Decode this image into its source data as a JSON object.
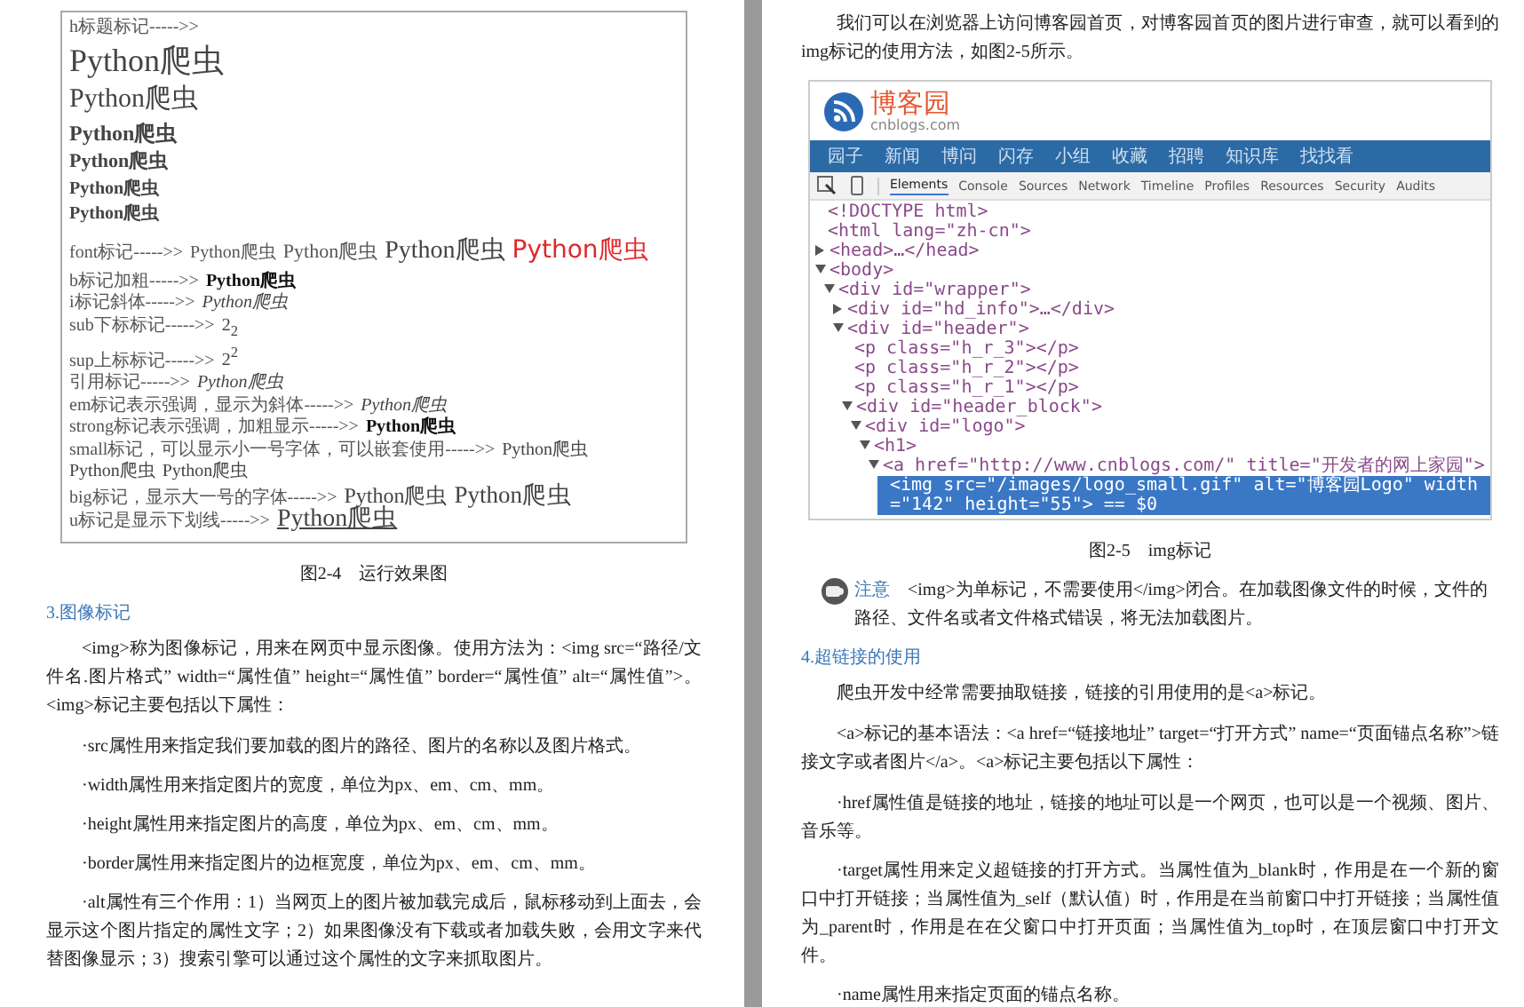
{
  "left_page": {
    "figure": {
      "label": "h标题标记----->>",
      "headings": [
        "Python爬虫",
        "Python爬虫",
        "Python爬虫",
        "Python爬虫",
        "Python爬虫",
        "Python爬虫"
      ],
      "font_line": {
        "label": "font标记----->>",
        "samples": [
          {
            "text": "Python爬虫",
            "kind": "small",
            "color": "#555555"
          },
          {
            "text": "Python爬虫",
            "kind": "normal",
            "color": "#555555"
          },
          {
            "text": "Python爬虫",
            "kind": "large",
            "color": "#444444"
          },
          {
            "text": "Python爬虫",
            "kind": "large",
            "color": "#e02828"
          }
        ]
      },
      "rows": [
        {
          "kind": "bold",
          "label": "b标记加粗----->>",
          "samples": [
            "Python爬虫"
          ]
        },
        {
          "kind": "italic",
          "label": "i标记斜体----->>",
          "samples": [
            "Python爬虫"
          ]
        },
        {
          "kind": "sub",
          "label": "sub下标标记----->>",
          "samples": [
            "2$_{2}$"
          ]
        },
        {
          "kind": "sup",
          "label": "sup上标标记----->>",
          "samples": [
            "2$^{2}$"
          ]
        },
        {
          "kind": "italic",
          "label": "引用标记----->>",
          "samples": [
            "Python爬虫"
          ]
        },
        {
          "kind": "italic",
          "label": "em标记表示强调，显示为斜体----->>",
          "samples": [
            "Python爬虫"
          ]
        },
        {
          "kind": "bold",
          "label": "strong标记表示强调，加粗显示----->>",
          "samples": [
            "Python爬虫"
          ]
        },
        {
          "kind": "small",
          "label": "small标记，可以显示小一号字体，可以嵌套使用----->>",
          "samples": [
            "Python爬虫",
            "Python爬虫",
            "Python爬虫"
          ]
        },
        {
          "kind": "big",
          "label": "big标记，显示大一号的字体----->>",
          "samples": [
            "Python爬虫",
            "Python爬虫"
          ]
        },
        {
          "kind": "underline",
          "label": "u标记是显示下划线----->>",
          "samples": [
            "Python爬虫"
          ]
        }
      ]
    },
    "caption": "图2-4　运行效果图",
    "section_title": "3.图像标记",
    "paragraphs": [
      {
        "kind": "body",
        "text": "<img>称为图像标记，用来在网页中显示图像。使用方法为：<img src=“路径/文件名.图片格式” width=“属性值” height=“属性值” border=“属性值” alt=“属性值”>。<img>标记主要包括以下属性："
      },
      {
        "kind": "bullet",
        "text": "·src属性用来指定我们要加载的图片的路径、图片的名称以及图片格式。"
      },
      {
        "kind": "bullet",
        "text": "·width属性用来指定图片的宽度，单位为px、em、cm、mm。"
      },
      {
        "kind": "bullet",
        "text": "·height属性用来指定图片的高度，单位为px、em、cm、mm。"
      },
      {
        "kind": "bullet",
        "text": "·border属性用来指定图片的边框宽度，单位为px、em、cm、mm。"
      },
      {
        "kind": "bullet",
        "text": "·alt属性有三个作用：1）当网页上的图片被加载完成后，鼠标移动到上面去，会显示这个图片指定的属性文字；2）如果图像没有下载或者加载失败，会用文字来代替图像显示；3）搜索引擎可以通过这个属性的文字来抓取图片。"
      }
    ]
  },
  "right_page": {
    "intro": "我们可以在浏览器上访问博客园首页，对博客园首页的图片进行审查，就可以看到的img标记的使用方法，如图2-5所示。",
    "screenshot": {
      "logo_title": "博客园",
      "logo_subtitle": "cnblogs.com",
      "nav": [
        "园子",
        "新闻",
        "博问",
        "闪存",
        "小组",
        "收藏",
        "招聘",
        "知识库",
        "找找看"
      ],
      "devtools_tabs": [
        {
          "label": "Elements",
          "selected": true
        },
        {
          "label": "Console",
          "selected": false
        },
        {
          "label": "Sources",
          "selected": false
        },
        {
          "label": "Network",
          "selected": false
        },
        {
          "label": "Timeline",
          "selected": false
        },
        {
          "label": "Profiles",
          "selected": false
        },
        {
          "label": "Resources",
          "selected": false
        },
        {
          "label": "Security",
          "selected": false
        },
        {
          "label": "Audits",
          "selected": false
        }
      ],
      "dom_tree": [
        {
          "text": "<!DOCTYPE html>",
          "selected": false
        },
        {
          "text": "<html lang=\"zh-cn\">",
          "selected": false
        },
        {
          "text": "<head>…</head>",
          "expanded": false,
          "selected": false
        },
        {
          "text": "<body>",
          "expanded": true,
          "selected": false,
          "children": [
            {
              "text": "<div id=\"wrapper\">",
              "expanded": true,
              "selected": false,
              "children": [
                {
                  "text": "<div id=\"hd_info\">…</div>",
                  "expanded": false,
                  "selected": false
                },
                {
                  "text": "<div id=\"header\">",
                  "expanded": true,
                  "selected": false,
                  "children": [
                    {
                      "text": "<p class=\"h_r_3\"></p>",
                      "selected": false
                    },
                    {
                      "text": "<p class=\"h_r_2\"></p>",
                      "selected": false
                    },
                    {
                      "text": "<p class=\"h_r_1\"></p>",
                      "selected": false
                    },
                    {
                      "text": "<div id=\"header_block\">",
                      "expanded": true,
                      "selected": false,
                      "children": [
                        {
                          "text": "<div id=\"logo\">",
                          "expanded": true,
                          "selected": false,
                          "children": [
                            {
                              "text": "<h1>",
                              "expanded": true,
                              "selected": false,
                              "children": [
                                {
                                  "text": "<a href=\"http://www.cnblogs.com/\" title=\"开发者的网上家园\">",
                                  "expanded": true,
                                  "selected": false,
                                  "children": [
                                    {
                                      "text": "<img src=\"/images/logo_small.gif\" alt=\"博客园Logo\" width=\"142\" height=\"55\"> == $0",
                                      "selected": true
                                    }
                                  ]
                                }
                              ]
                            }
                          ]
                        }
                      ]
                    }
                  ]
                }
              ]
            }
          ]
        }
      ]
    },
    "caption": "图2-5　img标记",
    "note": {
      "label": "注意",
      "text": "<img>为单标记，不需要使用</img>闭合。在加载图像文件的时候，文件的路径、文件名或者文件格式错误，将无法加载图片。"
    },
    "section_title": "4.超链接的使用",
    "paragraphs": [
      {
        "kind": "body",
        "text": "爬虫开发中经常需要抽取链接，链接的引用使用的是<a>标记。"
      },
      {
        "kind": "body",
        "text": "<a>标记的基本语法：<a href=“链接地址” target=“打开方式” name=“页面锚点名称”>链接文字或者图片</a>。<a>标记主要包括以下属性："
      },
      {
        "kind": "bullet",
        "text": "·href属性值是链接的地址，链接的地址可以是一个网页，也可以是一个视频、图片、音乐等。"
      },
      {
        "kind": "bullet",
        "text": "·target属性用来定义超链接的打开方式。当属性值为_blank时，作用是在一个新的窗口中打开链接；当属性值为_self（默认值）时，作用是在当前窗口中打开链接；当属性值为_parent时，作用是在在父窗口中打开页面；当属性值为_top时，在顶层窗口中打开文件。"
      },
      {
        "kind": "bullet",
        "text": "·name属性用来指定页面的锚点名称。"
      }
    ]
  }
}
